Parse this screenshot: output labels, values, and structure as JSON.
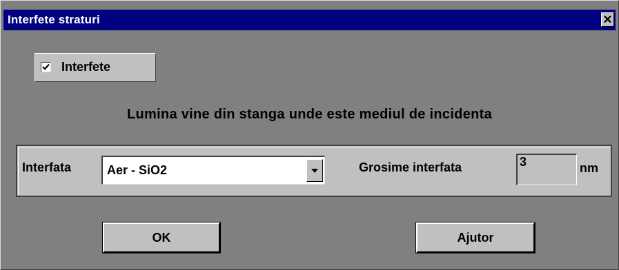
{
  "window": {
    "title": "Interfete straturi",
    "close_glyph": "✕"
  },
  "checkbox": {
    "label": "Interfete",
    "checked": true
  },
  "info_text": "Lumina vine din stanga unde este mediul de incidenta",
  "group": {
    "interface_label": "Interfata",
    "interface_selected": "Aer - SiO2",
    "thickness_label": "Grosime interfata",
    "thickness_value": "3",
    "thickness_unit": "nm"
  },
  "buttons": {
    "ok": "OK",
    "help": "Ajutor"
  },
  "colors": {
    "titlebar": "#000080",
    "window_bg": "#808080",
    "control_bg": "#c0c0c0"
  }
}
